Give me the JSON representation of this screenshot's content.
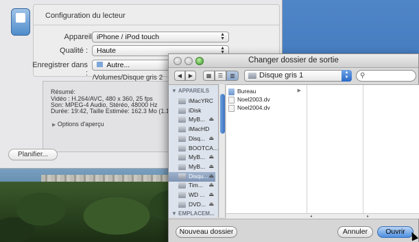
{
  "config": {
    "title": "Configuration du lecteur",
    "appareil_label": "Appareil :",
    "appareil_value": "iPhone / iPod touch",
    "qualite_label": "Qualité :",
    "qualite_value": "Haute",
    "enregistrer_label": "Enregistrer dans :",
    "enregistrer_value": "Autre...",
    "path": "/Volumes/Disque gris 2",
    "summary": {
      "heading": "Résumé:",
      "video": "Vidéo : H.264/AVC, 480 x 360, 25 fps",
      "son": "Son: MPEG-4 Audio, Stéréo, 48000 Hz",
      "duree": "Durée: 19:42, Taille Estimée: 162.3 Mo (1.1 Mo/s)"
    },
    "options_label": "Options d'aperçu",
    "planifier_label": "Planifier..."
  },
  "dialog": {
    "title": "Changer dossier de sortie",
    "location": "Disque gris 1",
    "search_placeholder": "",
    "sidebar": {
      "devices_heading": "APPAREILS",
      "places_heading": "EMPLACEM...",
      "items": [
        {
          "label": "iMacYRC",
          "eject": false,
          "selected": false
        },
        {
          "label": "iDisk",
          "eject": false,
          "selected": false
        },
        {
          "label": "MyB...",
          "eject": true,
          "selected": false
        },
        {
          "label": "iMacHD",
          "eject": false,
          "selected": false
        },
        {
          "label": "Disq...",
          "eject": true,
          "selected": false
        },
        {
          "label": "BOOTCA...",
          "eject": false,
          "selected": false
        },
        {
          "label": "MyB...",
          "eject": true,
          "selected": false
        },
        {
          "label": "MyB...",
          "eject": true,
          "selected": false
        },
        {
          "label": "Disqu...",
          "eject": true,
          "selected": true
        },
        {
          "label": "Tim...",
          "eject": true,
          "selected": false
        },
        {
          "label": "WD ...",
          "eject": true,
          "selected": false
        },
        {
          "label": "DVD...",
          "eject": true,
          "selected": false
        }
      ]
    },
    "files": [
      {
        "name": "Bureau",
        "type": "folder"
      },
      {
        "name": "Noel2003.dv",
        "type": "doc"
      },
      {
        "name": "Noel2004.dv",
        "type": "doc"
      }
    ],
    "new_folder_label": "Nouveau dossier",
    "cancel_label": "Annuler",
    "open_label": "Ouvrir"
  }
}
